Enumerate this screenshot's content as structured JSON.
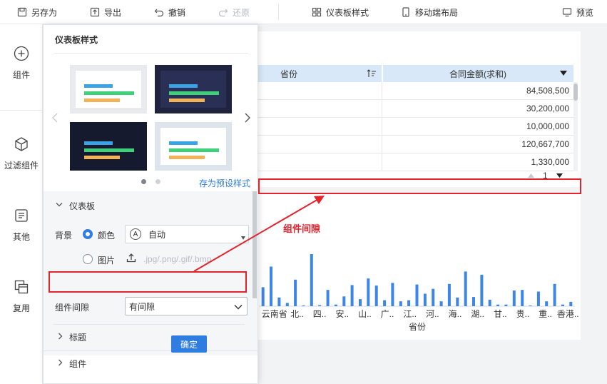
{
  "toolbar": {
    "save_as": "另存为",
    "export": "导出",
    "undo": "撤销",
    "redo": "还原",
    "dashboard_style": "仪表板样式",
    "mobile_layout": "移动端布局",
    "preview": "预览"
  },
  "sidebar": {
    "items": [
      {
        "label": "组件",
        "icon": "plus-circle-icon"
      },
      {
        "label": "过滤组件",
        "icon": "cube-icon"
      },
      {
        "label": "其他",
        "icon": "text-doc-icon"
      },
      {
        "label": "复用",
        "icon": "copy-stack-icon"
      }
    ]
  },
  "panel": {
    "title": "仪表板样式",
    "save_preset": "存为预设样式",
    "section_dashboard": "仪表板",
    "background_label": "背景",
    "option_color": "颜色",
    "auto_label": "自动",
    "auto_icon_letter": "A",
    "option_image": "图片",
    "image_placeholder": ".jpg/.png/.gif/.bmp",
    "gap_label": "组件间隙",
    "gap_value": "有间隙",
    "section_title": "标题",
    "section_component": "组件",
    "confirm_partial": "确定"
  },
  "table": {
    "col_province": "省份",
    "col_amount": "合同金额(求和)",
    "rows": [
      "84,508,500",
      "30,200,000",
      "10,000,000",
      "120,667,700",
      "1,330,000"
    ],
    "page": "1"
  },
  "annotation": {
    "label": "组件间隙"
  },
  "chart_data": {
    "type": "bar",
    "xlabel": "省份",
    "tick_labels": [
      "云南省",
      "北..",
      "四..",
      "安..",
      "山..",
      "广..",
      "江..",
      "河..",
      "海..",
      "湖..",
      "甘..",
      "贵..",
      "重..",
      "香港.."
    ],
    "values": [
      0.35,
      0.73,
      0.16,
      0.06,
      0.49,
      0.01,
      0.96,
      0.02,
      0.3,
      0.03,
      0.18,
      0.39,
      0.13,
      0.51,
      0.38,
      0.11,
      0.43,
      0.09,
      0.11,
      0.4,
      0.23,
      0.32,
      0.09,
      0.41,
      0.16,
      0.64,
      0.17,
      0.58,
      0.12,
      0.03,
      0.03,
      0.29,
      0.3,
      0.01,
      0.27,
      0.09,
      0.41,
      0.03,
      0.08
    ],
    "color": "#3d85e6"
  },
  "colors": {
    "accent": "#2f7de1",
    "highlight": "#e5232c",
    "bar": "#3d85e6",
    "header_bg": "#d8e8f8",
    "thumb_blue": "#3aa2e6",
    "thumb_green": "#3fd07a",
    "thumb_orange": "#f0b35a"
  }
}
